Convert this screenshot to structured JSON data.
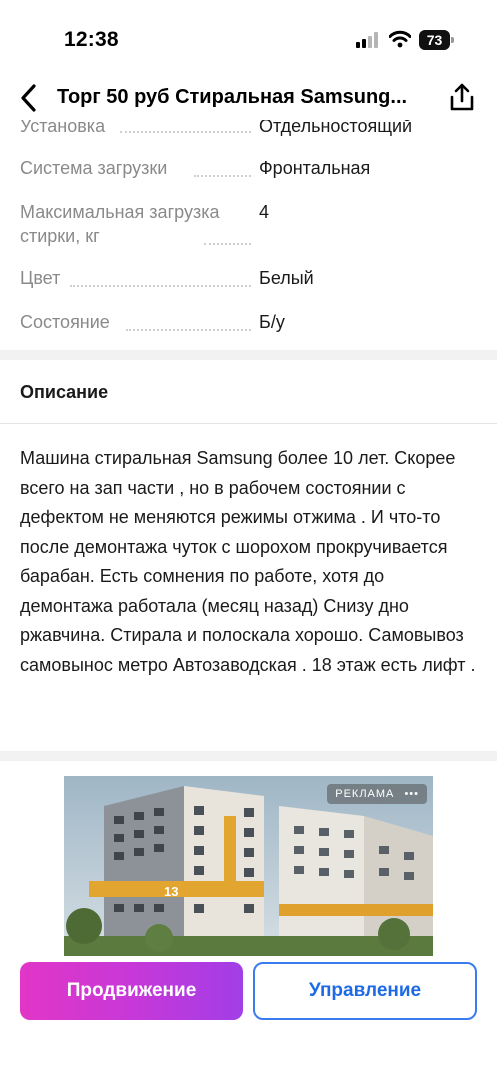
{
  "status_bar": {
    "time": "12:38",
    "battery": "73"
  },
  "nav": {
    "title": "Торг 50 руб Стиральная Samsung..."
  },
  "specs": [
    {
      "label": "Установка",
      "value": "Отдельностоящий"
    },
    {
      "label": "Система загрузки",
      "value": "Фронтальная"
    },
    {
      "label": "Максимальная загрузка стирки, кг",
      "value": "4"
    },
    {
      "label": "Цвет",
      "value": "Белый"
    },
    {
      "label": "Состояние",
      "value": "Б/у"
    }
  ],
  "description": {
    "title": "Описание",
    "text": "Машина стиральная Samsung более 10 лет. Скорее всего на зап части , но в рабочем состоянии с дефектом не меняются режимы отжима . И что-то после демонтажа чуток с шорохом прокручивается барабан. Есть сомнения по работе, хотя до демонтажа работала (месяц назад) Снизу дно ржавчина. Стирала и полоскала хорошо. Самовывоз самовынос метро Автозаводская . 18 этаж есть лифт ."
  },
  "ad": {
    "label": "РЕКЛАМА",
    "more": "•••",
    "building_number": "13"
  },
  "actions": {
    "promo_label": "Продвижение",
    "manage_label": "Управление"
  },
  "colors": {
    "promo_gradient_start": "#e236c7",
    "promo_gradient_end": "#a23ee6",
    "manage_accent": "#1e6ae6"
  }
}
